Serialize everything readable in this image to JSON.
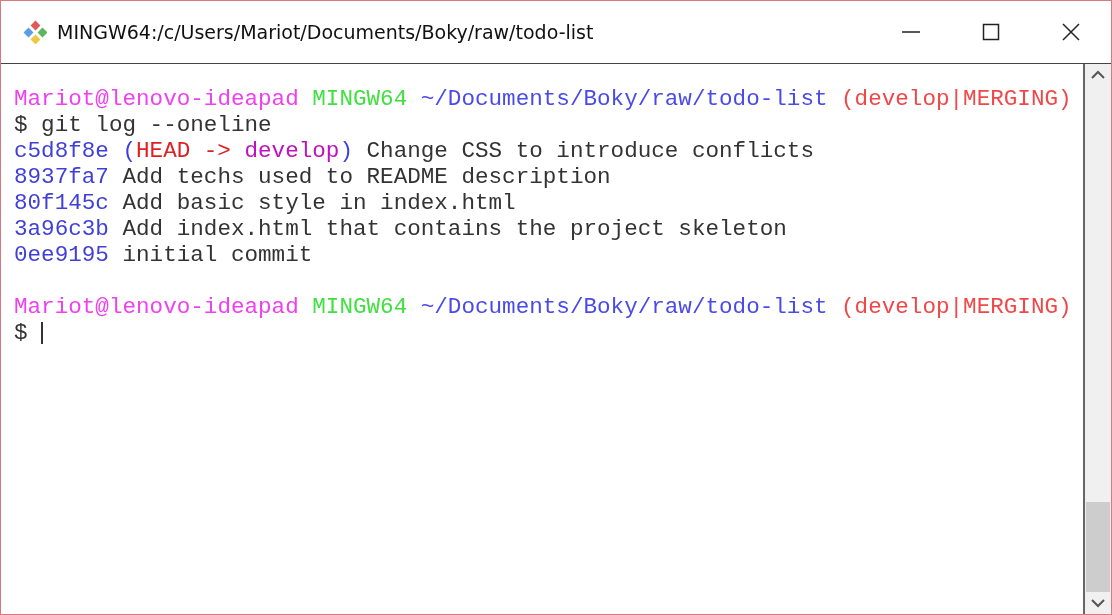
{
  "window": {
    "title": "MINGW64:/c/Users/Mariot/Documents/Boky/raw/todo-list"
  },
  "sessions": [
    {
      "prompt": [
        {
          "kind": "user",
          "text": "Mariot@lenovo-ideapad"
        },
        {
          "kind": "system",
          "text": "MINGW64"
        },
        {
          "kind": "path",
          "text": "~/Documents/Boky/raw/todo-list"
        },
        {
          "kind": "branch",
          "text": "(develop|MERGING)"
        }
      ],
      "sign": "$",
      "command": "git log --oneline",
      "output": [
        {
          "segments": [
            {
              "kind": "hash",
              "text": "c5d8f8e"
            },
            {
              "kind": "paren",
              "text": "("
            },
            {
              "kind": "head",
              "text": "HEAD",
              "tight": true
            },
            {
              "kind": "head",
              "text": "->"
            },
            {
              "kind": "ref",
              "text": "develop"
            },
            {
              "kind": "paren",
              "text": ")",
              "tight": true
            },
            {
              "kind": "text",
              "text": "Change CSS to introduce conflicts"
            }
          ]
        },
        {
          "segments": [
            {
              "kind": "hash",
              "text": "8937fa7"
            },
            {
              "kind": "text",
              "text": "Add techs used to README description"
            }
          ]
        },
        {
          "segments": [
            {
              "kind": "hash",
              "text": "80f145c"
            },
            {
              "kind": "text",
              "text": "Add basic style in index.html"
            }
          ]
        },
        {
          "segments": [
            {
              "kind": "hash",
              "text": "3a96c3b"
            },
            {
              "kind": "text",
              "text": "Add index.html that contains the project skeleton"
            }
          ]
        },
        {
          "segments": [
            {
              "kind": "hash",
              "text": "0ee9195"
            },
            {
              "kind": "text",
              "text": "initial commit"
            }
          ]
        }
      ]
    },
    {
      "prompt": [
        {
          "kind": "user",
          "text": "Mariot@lenovo-ideapad"
        },
        {
          "kind": "system",
          "text": "MINGW64"
        },
        {
          "kind": "path",
          "text": "~/Documents/Boky/raw/todo-list"
        },
        {
          "kind": "branch",
          "text": "(develop|MERGING)"
        }
      ],
      "sign": "$",
      "cursor": true
    }
  ]
}
